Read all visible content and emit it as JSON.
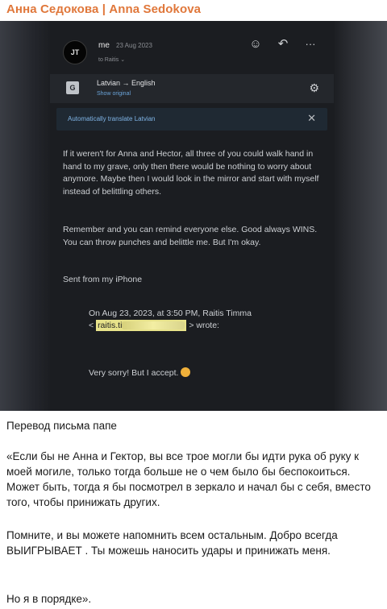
{
  "header": {
    "channel_title": "Анна Седокова | Anna Sedokova"
  },
  "email": {
    "avatar_text": "JT",
    "sender": "me",
    "date": "23 Aug 2023",
    "to": "to Raitis ⌄",
    "actions": {
      "emoji_icon": "☺",
      "reply_icon": "↶",
      "more_icon": "···"
    },
    "translation": {
      "icon_text": "G",
      "languages": "Latvian → English",
      "show_original": "Show original",
      "settings_icon": "⚙",
      "auto_translate": "Automatically translate Latvian",
      "close_icon": "✕"
    },
    "paragraphs": [
      "If it weren't for Anna and Hector, all three of you could walk hand in hand to my grave, only then there would be nothing to worry about anymore. Maybe then I would look in the mirror and start with myself instead of belittling others.",
      "Remember and you can remind everyone else. Good always WINS. You can throw punches and belittle me. But I'm okay.",
      "Sent from my iPhone"
    ],
    "quote_header": "On Aug 23, 2023, at 3:50 PM, Raitis Timma",
    "quote_email_prefix": "<",
    "quote_email_visible": "raitis.ti",
    "quote_email_suffix": "> wrote:",
    "quote_reply": "Very sorry! But I accept."
  },
  "caption": {
    "title": "Перевод письма папе",
    "paragraphs": [
      "«Если бы не Анна и Гектор, вы все трое могли бы идти рука об руку к моей могиле, только тогда больше не о чем было бы беспокоиться. Может быть, тогда я бы посмотрел в зеркало и начал бы с себя, вместо того, чтобы принижать других.",
      "Помните, и вы можете напомнить всем остальным. Добро всегда ВЫИГРЫВАЕТ . Ты можешь наносить удары и принижать меня.",
      "Но я в порядке»."
    ]
  }
}
